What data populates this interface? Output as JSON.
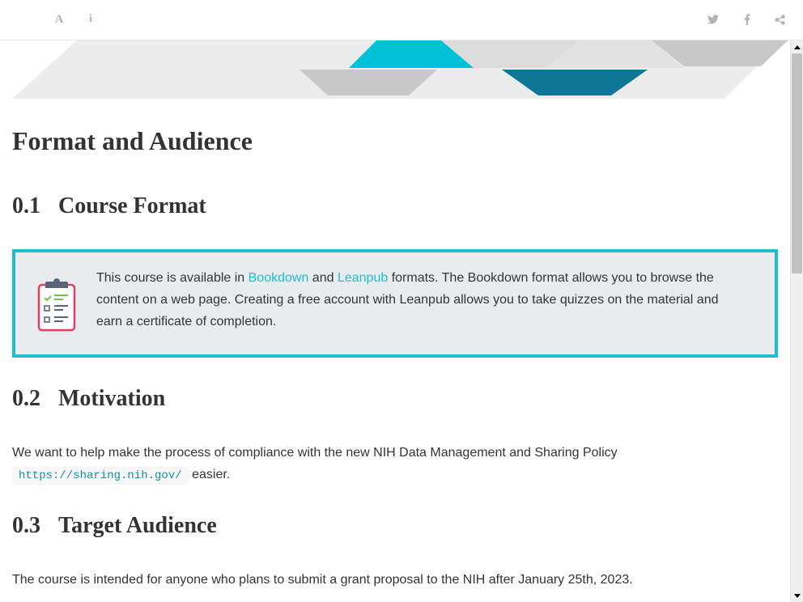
{
  "toolbar": {
    "font_settings_icon": "font-a-icon",
    "info_glyph": "i",
    "font_glyph": "A",
    "twitter_icon": "twitter-icon",
    "facebook_icon": "facebook-icon",
    "share_icon": "share-icon"
  },
  "page": {
    "title": "Format and Audience"
  },
  "sections": [
    {
      "number": "0.1",
      "title": "Course Format"
    },
    {
      "number": "0.2",
      "title": "Motivation"
    },
    {
      "number": "0.3",
      "title": "Target Audience"
    }
  ],
  "callout": {
    "icon": "clipboard-checklist-icon",
    "text_1": "This course is available in ",
    "link_bookdown": "Bookdown",
    "text_2": " and ",
    "link_leanpub": "Leanpub",
    "text_3": " formats. The Bookdown format allows you to browse the content on a web page. Creating a free account with Leanpub allows you to take quizzes on the material and earn a certificate of completion."
  },
  "motivation": {
    "text_1": "We want to help make the process of compliance with the new NIH Data Management and Sharing Policy",
    "code": "https://sharing.nih.gov/",
    "text_2": " easier."
  },
  "audience": {
    "text": "The course is intended for anyone who plans to submit a grant proposal to the NIH after January 25th, 2023."
  },
  "colors": {
    "accent": "#1fbdcf",
    "banner_teal_light": "#00c1d5",
    "banner_teal_dark": "#0f7796",
    "banner_grey": "#c8c8c8",
    "callout_bg": "#e9ecef"
  }
}
